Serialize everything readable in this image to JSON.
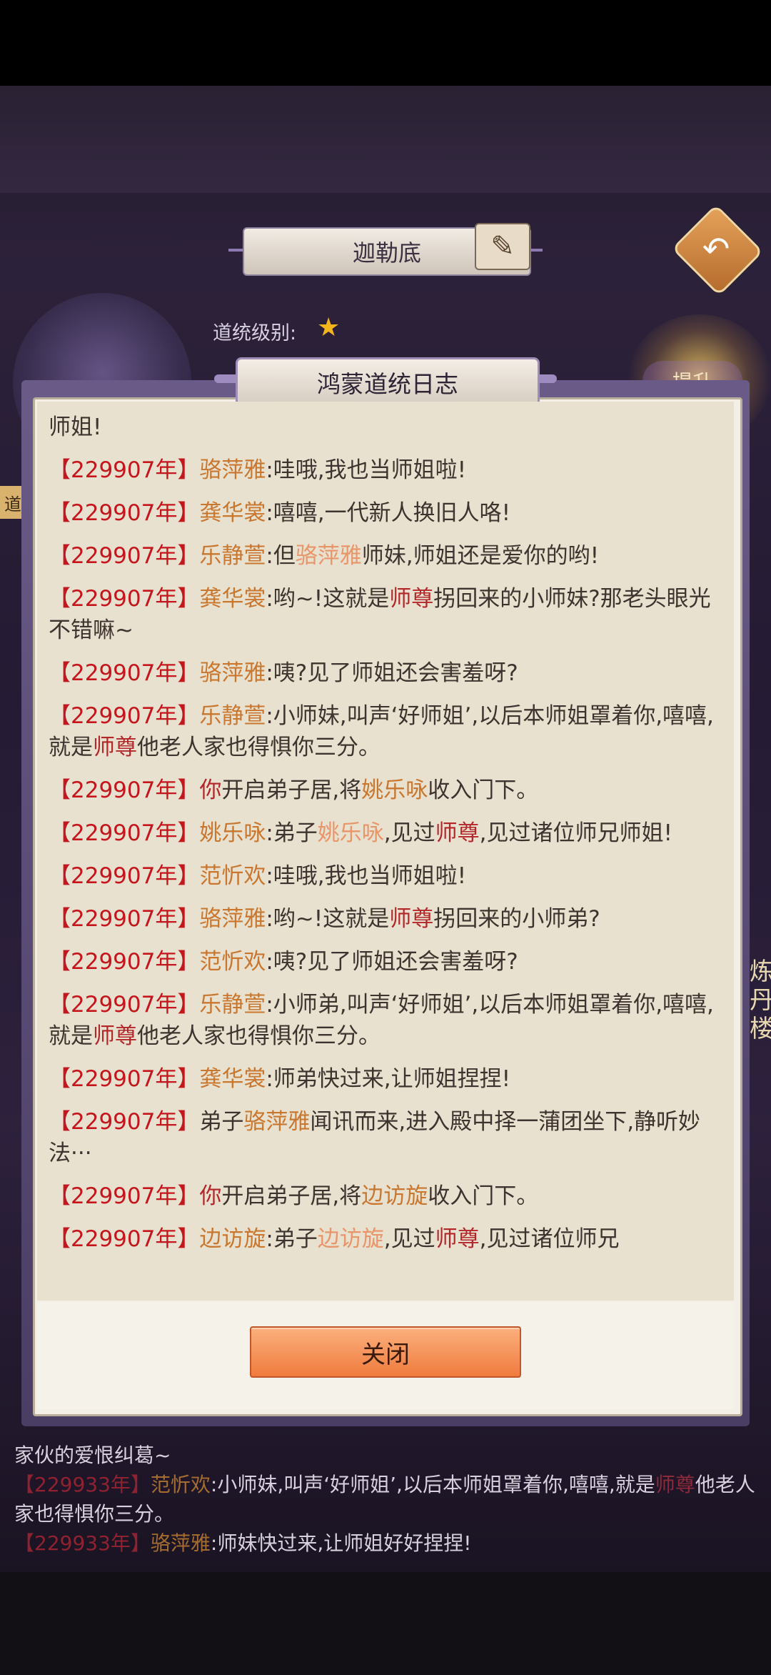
{
  "header": {
    "title": "迦勒底",
    "level_label": "道统级别:",
    "upgrade_label": "提升",
    "side_tag": "道",
    "side_label": "炼丹楼"
  },
  "dialog": {
    "title": "鸿蒙道统日志",
    "close_label": "关闭",
    "entries": [
      {
        "segments": [
          {
            "t": "师姐!",
            "c": "txt"
          }
        ]
      },
      {
        "segments": [
          {
            "t": "【229907年】",
            "c": "yr"
          },
          {
            "t": "骆萍雅",
            "c": "nm"
          },
          {
            "t": ":哇哦,我也当师姐啦!",
            "c": "txt"
          }
        ]
      },
      {
        "segments": [
          {
            "t": "【229907年】",
            "c": "yr"
          },
          {
            "t": "龚华裳",
            "c": "nm"
          },
          {
            "t": ":嘻嘻,一代新人换旧人咯!",
            "c": "txt"
          }
        ]
      },
      {
        "segments": [
          {
            "t": "【229907年】",
            "c": "yr"
          },
          {
            "t": "乐静萱",
            "c": "nm"
          },
          {
            "t": ":但",
            "c": "txt"
          },
          {
            "t": "骆萍雅",
            "c": "pk"
          },
          {
            "t": "师妹,师姐还是爱你的哟!",
            "c": "txt"
          }
        ]
      },
      {
        "segments": [
          {
            "t": "【229907年】",
            "c": "yr"
          },
          {
            "t": "龚华裳",
            "c": "nm"
          },
          {
            "t": ":哟~!这就是",
            "c": "txt"
          },
          {
            "t": "师尊",
            "c": "zun"
          },
          {
            "t": "拐回来的小师妹?那老头眼光不错嘛~",
            "c": "txt"
          }
        ]
      },
      {
        "segments": [
          {
            "t": "【229907年】",
            "c": "yr"
          },
          {
            "t": "骆萍雅",
            "c": "nm"
          },
          {
            "t": ":咦?见了师姐还会害羞呀?",
            "c": "txt"
          }
        ]
      },
      {
        "segments": [
          {
            "t": "【229907年】",
            "c": "yr"
          },
          {
            "t": "乐静萱",
            "c": "nm"
          },
          {
            "t": ":小师妹,叫声‘好师姐’,以后本师姐罩着你,嘻嘻,就是",
            "c": "txt"
          },
          {
            "t": "师尊",
            "c": "zun"
          },
          {
            "t": "他老人家也得惧你三分。",
            "c": "txt"
          }
        ]
      },
      {
        "segments": [
          {
            "t": "【229907年】",
            "c": "yr"
          },
          {
            "t": "你",
            "c": "zun"
          },
          {
            "t": "开启弟子居,将",
            "c": "txt"
          },
          {
            "t": "姚乐咏",
            "c": "nm"
          },
          {
            "t": "收入门下。",
            "c": "txt"
          }
        ]
      },
      {
        "segments": [
          {
            "t": "【229907年】",
            "c": "yr"
          },
          {
            "t": "姚乐咏",
            "c": "nm"
          },
          {
            "t": ":弟子",
            "c": "txt"
          },
          {
            "t": "姚乐咏",
            "c": "pk"
          },
          {
            "t": ",见过",
            "c": "txt"
          },
          {
            "t": "师尊",
            "c": "zun"
          },
          {
            "t": ",见过诸位师兄师姐!",
            "c": "txt"
          }
        ]
      },
      {
        "segments": [
          {
            "t": "【229907年】",
            "c": "yr"
          },
          {
            "t": "范忻欢",
            "c": "nm"
          },
          {
            "t": ":哇哦,我也当师姐啦!",
            "c": "txt"
          }
        ]
      },
      {
        "segments": [
          {
            "t": "【229907年】",
            "c": "yr"
          },
          {
            "t": "骆萍雅",
            "c": "nm"
          },
          {
            "t": ":哟~!这就是",
            "c": "txt"
          },
          {
            "t": "师尊",
            "c": "zun"
          },
          {
            "t": "拐回来的小师弟?",
            "c": "txt"
          }
        ]
      },
      {
        "segments": [
          {
            "t": "【229907年】",
            "c": "yr"
          },
          {
            "t": "范忻欢",
            "c": "nm"
          },
          {
            "t": ":咦?见了师姐还会害羞呀?",
            "c": "txt"
          }
        ]
      },
      {
        "segments": [
          {
            "t": "【229907年】",
            "c": "yr"
          },
          {
            "t": "乐静萱",
            "c": "nm"
          },
          {
            "t": ":小师弟,叫声‘好师姐’,以后本师姐罩着你,嘻嘻,就是",
            "c": "txt"
          },
          {
            "t": "师尊",
            "c": "zun"
          },
          {
            "t": "他老人家也得惧你三分。",
            "c": "txt"
          }
        ]
      },
      {
        "segments": [
          {
            "t": "【229907年】",
            "c": "yr"
          },
          {
            "t": "龚华裳",
            "c": "nm"
          },
          {
            "t": ":师弟快过来,让师姐捏捏!",
            "c": "txt"
          }
        ]
      },
      {
        "segments": [
          {
            "t": "【229907年】",
            "c": "yr"
          },
          {
            "t": "弟子",
            "c": "txt"
          },
          {
            "t": "骆萍雅",
            "c": "nm"
          },
          {
            "t": "闻讯而来,进入殿中择一蒲团坐下,静听妙法···",
            "c": "txt"
          }
        ]
      },
      {
        "segments": [
          {
            "t": "【229907年】",
            "c": "yr"
          },
          {
            "t": "你",
            "c": "zun"
          },
          {
            "t": "开启弟子居,将",
            "c": "txt"
          },
          {
            "t": "边访旋",
            "c": "nm"
          },
          {
            "t": "收入门下。",
            "c": "txt"
          }
        ]
      },
      {
        "segments": [
          {
            "t": "【229907年】",
            "c": "yr"
          },
          {
            "t": "边访旋",
            "c": "nm"
          },
          {
            "t": ":弟子",
            "c": "txt"
          },
          {
            "t": "边访旋",
            "c": "pk"
          },
          {
            "t": ",见过",
            "c": "txt"
          },
          {
            "t": "师尊",
            "c": "zun"
          },
          {
            "t": ",见过诸位师兄",
            "c": "txt"
          }
        ]
      }
    ]
  },
  "chat": {
    "lines": [
      {
        "segments": [
          {
            "t": "家伙的爱恨纠葛~",
            "c": "txt"
          }
        ]
      },
      {
        "segments": [
          {
            "t": "【229933年】",
            "c": "yr"
          },
          {
            "t": "范忻欢",
            "c": "nm"
          },
          {
            "t": ":小师妹,叫声‘好师姐’,以后本师姐罩着你,嘻嘻,就是",
            "c": "txt"
          },
          {
            "t": "师尊",
            "c": "zun"
          },
          {
            "t": "他老人家也得惧你三分。",
            "c": "txt"
          }
        ]
      },
      {
        "segments": [
          {
            "t": "【229933年】",
            "c": "yr"
          },
          {
            "t": "骆萍雅",
            "c": "nm"
          },
          {
            "t": ":师妹快过来,让师姐好好捏捏!",
            "c": "txt"
          }
        ]
      }
    ]
  },
  "icons": {
    "back": "back-arrow-icon",
    "scroll": "scroll-brush-icon",
    "star": "star-icon"
  },
  "colors": {
    "year": "#c4161c",
    "name": "#c9772f",
    "highlight": "#e8956a",
    "master": "#b3262a",
    "close_button": "#ef7b3d"
  }
}
